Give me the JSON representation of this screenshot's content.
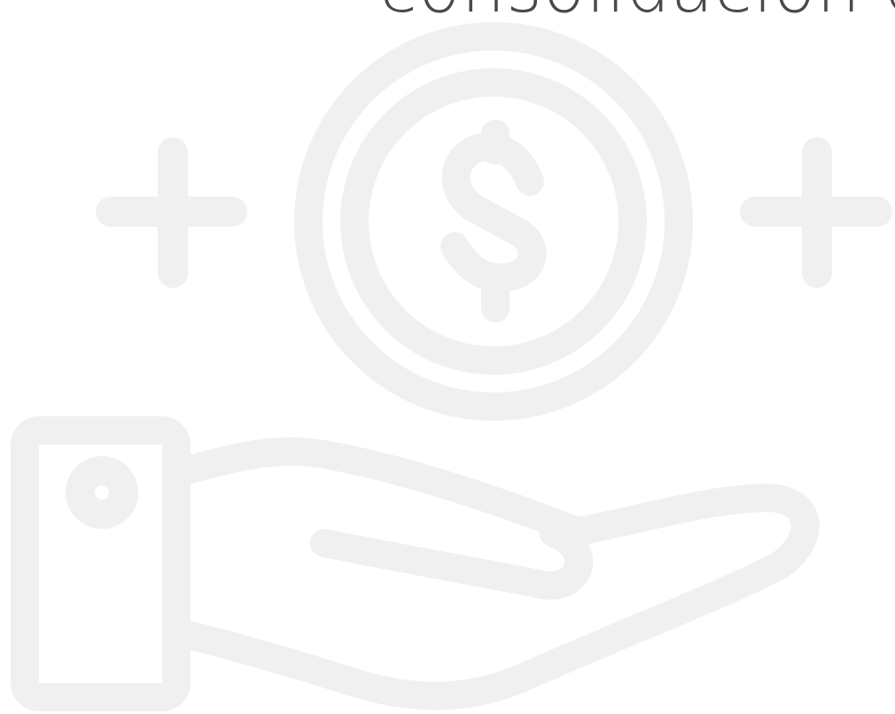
{
  "heading": {
    "text": "consolidación d"
  },
  "colors": {
    "background": "#ffffff",
    "heading_text": "#4a4a4a",
    "illustration_stroke": "#f0f0f0"
  },
  "illustration": {
    "icons": [
      "hand-icon",
      "coin-icon",
      "dollar-sign-icon",
      "plus-icon",
      "plus-icon"
    ]
  }
}
